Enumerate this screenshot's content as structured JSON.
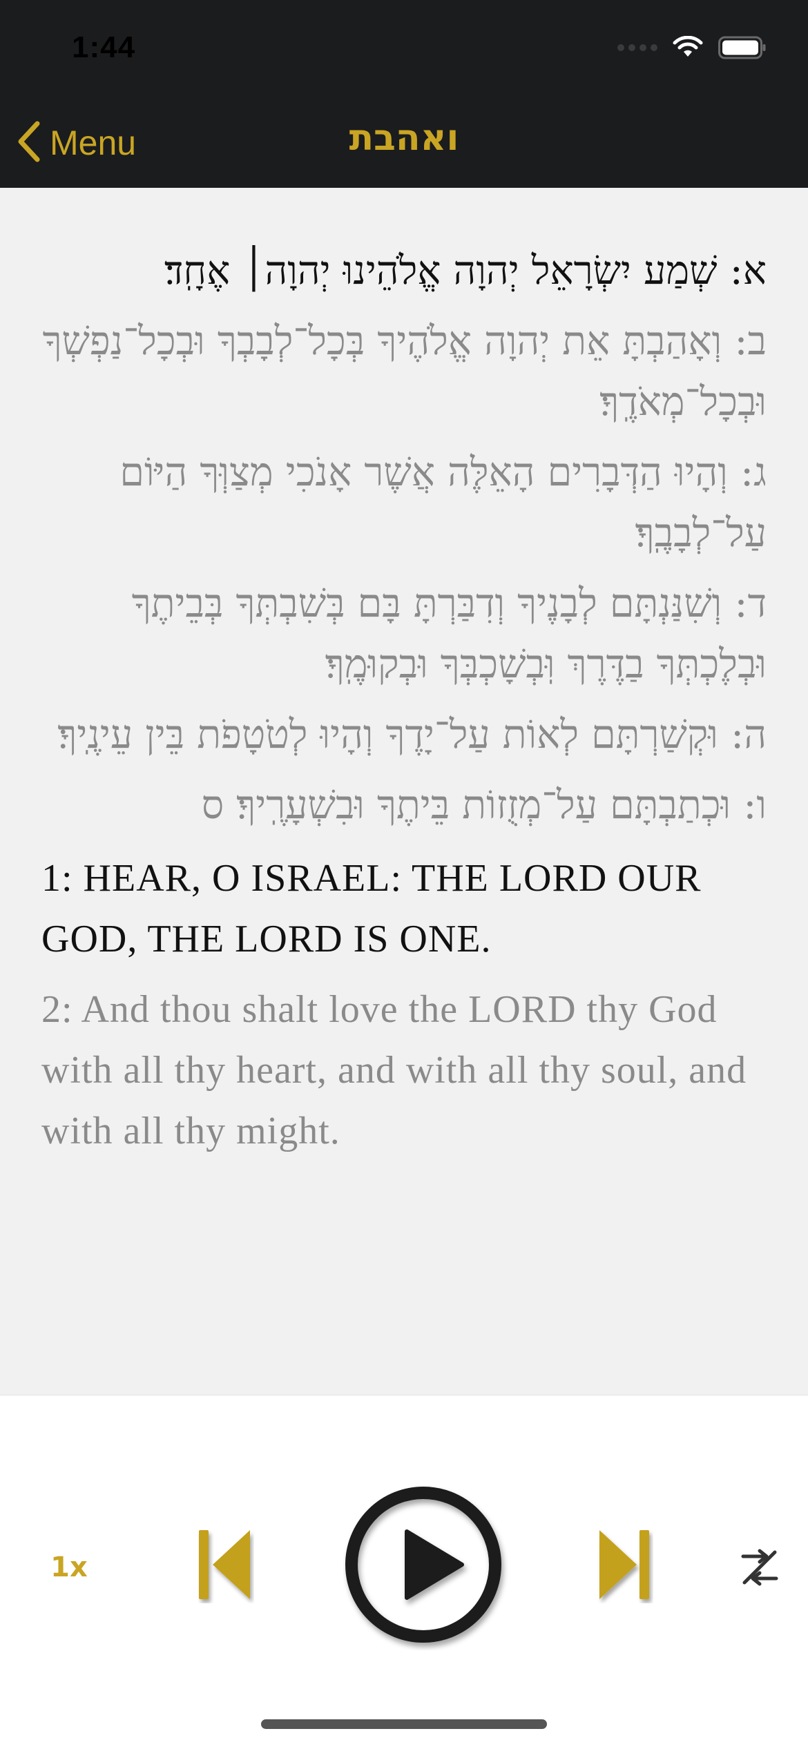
{
  "status_bar": {
    "time": "1:44"
  },
  "nav": {
    "back_label": "Menu",
    "title": "ואהבת"
  },
  "hebrew_verses": [
    {
      "text": "א: שְׁמַע יִשְׂרָאֵל יְהוָה אֱלֹהֵינוּ יְהוָה׀ אֶחָֽד׃"
    },
    {
      "text": "ב: וְאָהַבְתָּ אֵת יְהוָה אֱלֹהֶיךָ בְּכָל־לְבָבְךָ וּבְכָל־נַפְשְׁךָ וּבְכָל־מְאֹדֶֽךָ׃"
    },
    {
      "text": "ג: וְהָיוּ הַדְּבָרִים הָאֵלֶּה אֲשֶׁר אָנֹכִי מְצַוְּךָ הַיּוֹם עַל־לְבָבֶֽךָ׃"
    },
    {
      "text": "ד: וְשִׁנַּנְתָּם לְבָנֶיךָ וְדִבַּרְתָּ בָּם בְּשִׁבְתְּךָ בְּבֵיתֶךָ וּבְלֶכְתְּךָ בַדֶּרֶךְ וּֽבְשָׁכְבְּךָ וּבְקוּמֶֽךָ׃"
    },
    {
      "text": "ה: וּקְשַׁרְתָּם לְאוֹת עַל־יָדֶךָ וְהָיוּ לְטֹטָפֹת בֵּין עֵינֶֽיךָ׃"
    },
    {
      "text": "ו: וּכְתַבְתָּם עַל־מְזֻזוֹת בֵּיתֶךָ וּבִשְׁעָרֶֽיךָ׃ ס"
    }
  ],
  "english_verses": [
    {
      "text": "1: HEAR, O ISRAEL: THE LORD OUR GOD, THE LORD IS ONE."
    },
    {
      "text": "2: And thou shalt love the LORD thy God with all thy heart, and with all thy soul, and with all thy might."
    }
  ],
  "player": {
    "speed_label": "1x"
  },
  "icons": {
    "back": "chevron-left-icon",
    "previous": "skip-previous-icon",
    "play": "play-circle-icon",
    "next": "skip-next-icon",
    "shuffle": "shuffle-off-icon",
    "wifi": "wifi-icon",
    "battery": "battery-icon"
  },
  "colors": {
    "accent": "#c9a524",
    "header_background": "#1b1c1e",
    "active_text": "#111111",
    "inactive_text": "#8a8a8a"
  }
}
